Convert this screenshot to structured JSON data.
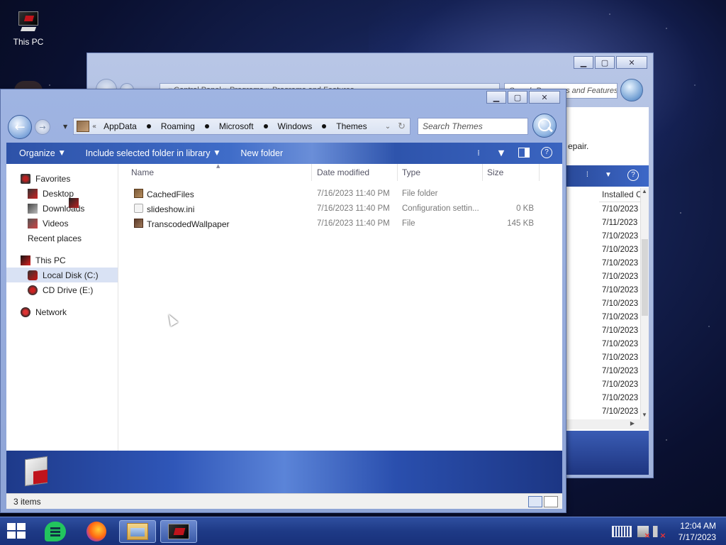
{
  "desktop": {
    "icons": [
      {
        "label": "This PC",
        "icon": "this-pc-icon"
      }
    ]
  },
  "background_window": {
    "address_text": "« Control Panel » Programs » Programs and Features",
    "search_placeholder": "Search Programs and Features",
    "repair_text": "epair.",
    "column_header": "Installed C",
    "installed_dates": [
      "7/10/2023",
      "7/11/2023",
      "7/10/2023",
      "7/10/2023",
      "7/10/2023",
      "7/10/2023",
      "7/10/2023",
      "7/10/2023",
      "7/10/2023",
      "7/10/2023",
      "7/10/2023",
      "7/10/2023",
      "7/10/2023",
      "7/10/2023",
      "7/10/2023",
      "7/10/2023"
    ]
  },
  "window": {
    "controls": {
      "minimize": "▁",
      "maximize": "▢",
      "close": "✕"
    },
    "breadcrumb": {
      "overflow": "«",
      "items": [
        "AppData",
        "Roaming",
        "Microsoft",
        "Windows",
        "Themes"
      ]
    },
    "search_placeholder": "Search Themes",
    "toolbar": {
      "organize": "Organize",
      "include_library": "Include selected folder in library",
      "new_folder": "New folder",
      "help": "?"
    },
    "nav": {
      "favorites": {
        "label": "Favorites",
        "items": [
          "Desktop",
          "Downloads",
          "Videos",
          "Recent places"
        ]
      },
      "this_pc": {
        "label": "This PC",
        "items": [
          "Local Disk (C:)",
          "CD Drive (E:)"
        ],
        "selected": "Local Disk (C:)"
      },
      "network": {
        "label": "Network"
      }
    },
    "columns": {
      "name": "Name",
      "date_modified": "Date modified",
      "type": "Type",
      "size": "Size"
    },
    "files": [
      {
        "name": "CachedFiles",
        "date": "7/16/2023 11:40 PM",
        "type": "File folder",
        "size": "",
        "icon": "folder-icon"
      },
      {
        "name": "slideshow.ini",
        "date": "7/16/2023 11:40 PM",
        "type": "Configuration settin...",
        "size": "0 KB",
        "icon": "ini-file-icon"
      },
      {
        "name": "TranscodedWallpaper",
        "date": "7/16/2023 11:40 PM",
        "type": "File",
        "size": "145 KB",
        "icon": "file-icon"
      }
    ],
    "status": {
      "item_count": "3 items"
    }
  },
  "taskbar": {
    "apps": [
      "start-icon",
      "notes-app-icon",
      "firefox-icon",
      "file-explorer-icon",
      "this-pc-icon"
    ],
    "clock": {
      "time": "12:04 AM",
      "date": "7/17/2023"
    }
  }
}
